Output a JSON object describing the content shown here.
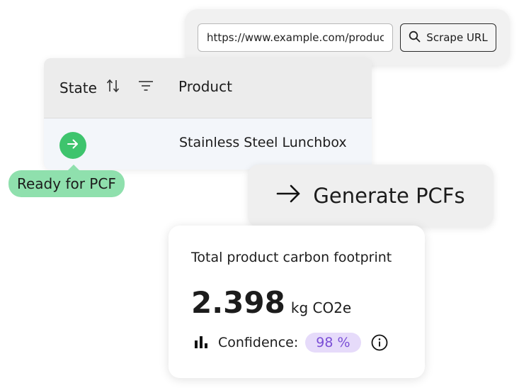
{
  "scraper": {
    "url_value": "https://www.example.com/product",
    "button_label": "Scrape URL"
  },
  "table": {
    "columns": [
      "State",
      "Product"
    ],
    "rows": [
      {
        "state_icon": "arrow-right-icon",
        "state_color": "#3ec46d",
        "product": "Stainless Steel Lunchbox"
      }
    ]
  },
  "tooltip": {
    "label": "Ready for PCF"
  },
  "generate": {
    "label": "Generate PCFs"
  },
  "result": {
    "title": "Total product carbon footprint",
    "value": "2.398",
    "unit": "kg CO2e",
    "confidence_label": "Confidence:",
    "confidence_value": "98 %"
  },
  "colors": {
    "green": "#3ec46d",
    "tooltip_green": "#8fe0ad",
    "purple_text": "#7b4fd6",
    "purple_bg": "#e6dbfa"
  }
}
